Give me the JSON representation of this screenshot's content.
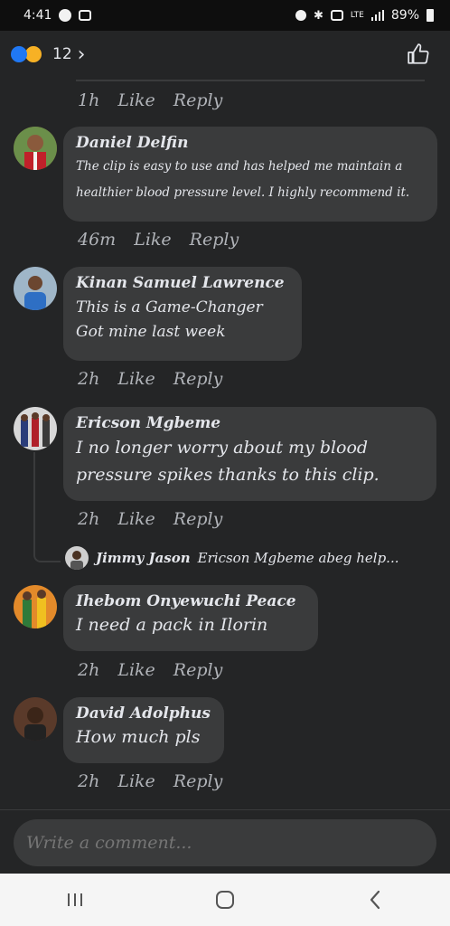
{
  "status_bar": {
    "time": "4:41",
    "battery": "89%",
    "network": "LTE"
  },
  "header": {
    "reaction_count": "12",
    "chevron": "›"
  },
  "prev_comment_meta": {
    "time": "1h",
    "like": "Like",
    "reply": "Reply"
  },
  "comments": [
    {
      "name": "Daniel Delfin",
      "text": "The clip is easy to use and has helped me maintain a\nhealthier blood pressure level. I highly recommend it.",
      "time": "46m",
      "like": "Like",
      "reply": "Reply"
    },
    {
      "name": "Kinan Samuel Lawrence",
      "text": "This is a Game-Changer\nGot mine last week",
      "time": "2h",
      "like": "Like",
      "reply": "Reply"
    },
    {
      "name": "Ericson Mgbeme",
      "text": "I no longer worry about my blood\npressure spikes thanks to this clip.",
      "time": "2h",
      "like": "Like",
      "reply": "Reply"
    },
    {
      "name": "Ihebom Onyewuchi Peace",
      "text": "I need a pack in Ilorin",
      "time": "2h",
      "like": "Like",
      "reply": "Reply"
    },
    {
      "name": "David Adolphus",
      "text": "How much pls",
      "time": "2h",
      "like": "Like",
      "reply": "Reply"
    }
  ],
  "nested_reply": {
    "name": "Jimmy Jason",
    "text": "Ericson Mgbeme abeg help..."
  },
  "composer": {
    "placeholder": "Write a comment..."
  },
  "colors": {
    "background": "#242526",
    "bubble": "#3a3b3c",
    "like_blue": "#2078f4",
    "haha_yellow": "#f7b125"
  }
}
